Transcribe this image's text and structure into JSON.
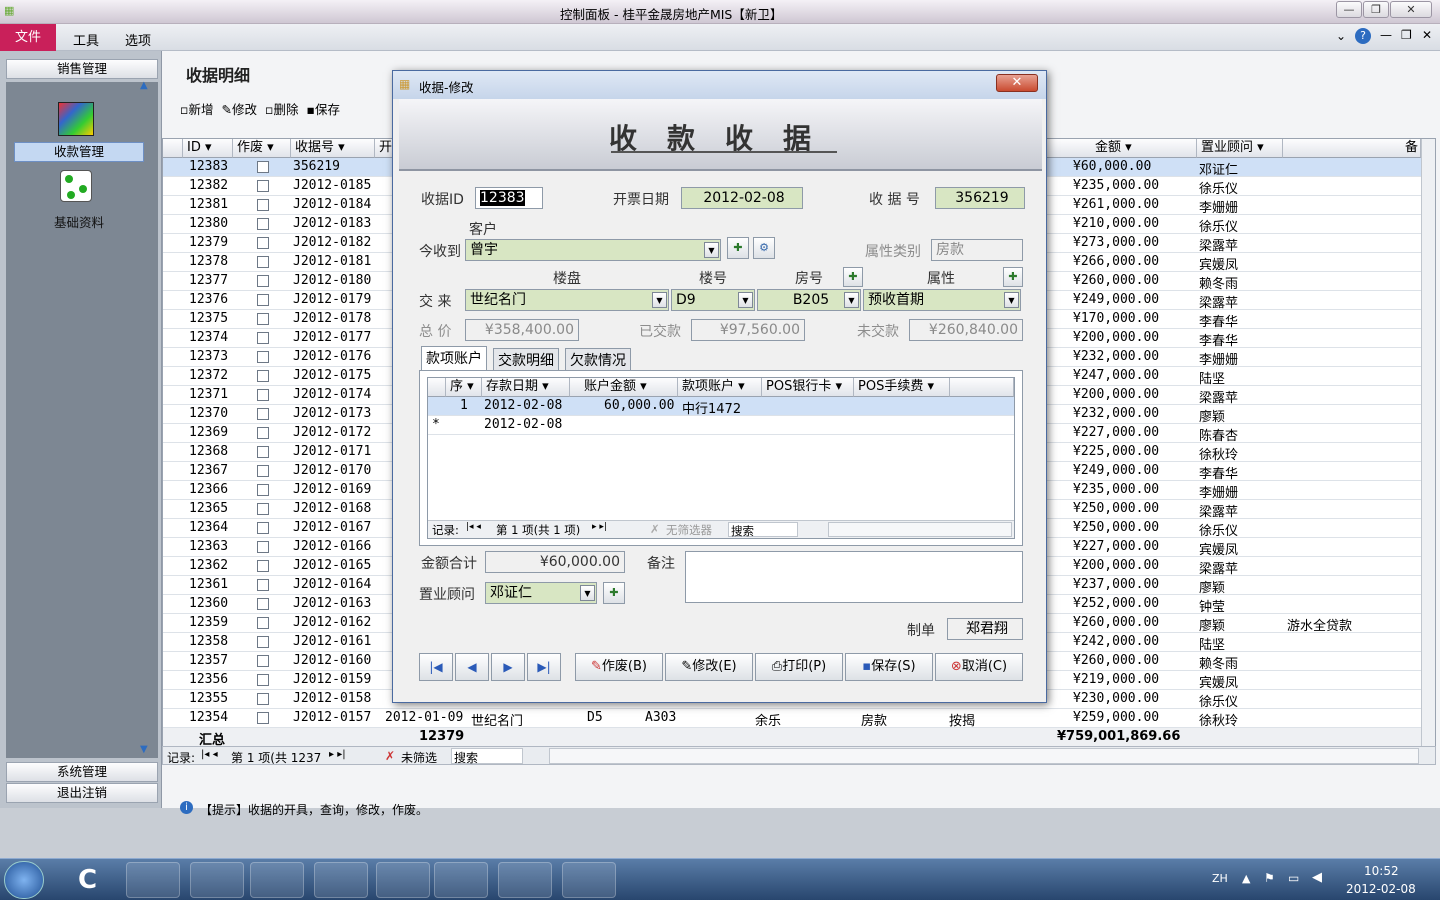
{
  "window": {
    "title": "控制面板 - 桂平金晟房地产MIS【新卫】"
  },
  "menu": {
    "file": "文件",
    "tools": "工具",
    "options": "选项"
  },
  "nav": {
    "sales": "销售管理",
    "items": [
      {
        "label": "收款管理",
        "icon": "receipt-icon"
      },
      {
        "label": "基础资料",
        "icon": "data-icon"
      }
    ],
    "system": "系统管理",
    "logout": "退出注销"
  },
  "page": {
    "title": "收据明细"
  },
  "toolbar": {
    "add": "新增",
    "edit": "修改",
    "delete": "删除",
    "save": "保存"
  },
  "grid": {
    "headers": [
      "ID",
      "作废",
      "收据号",
      "开",
      "金额",
      "置业顾问",
      "备"
    ],
    "rows": [
      {
        "id": "12383",
        "no": "356219",
        "amt": "¥60,000.00",
        "adv": "邓证仁",
        "sel": true
      },
      {
        "id": "12382",
        "no": "J2012-0185",
        "amt": "¥235,000.00",
        "adv": "徐乐仪"
      },
      {
        "id": "12381",
        "no": "J2012-0184",
        "amt": "¥261,000.00",
        "adv": "李姗姗"
      },
      {
        "id": "12380",
        "no": "J2012-0183",
        "amt": "¥210,000.00",
        "adv": "徐乐仪"
      },
      {
        "id": "12379",
        "no": "J2012-0182",
        "amt": "¥273,000.00",
        "adv": "梁露苹"
      },
      {
        "id": "12378",
        "no": "J2012-0181",
        "amt": "¥266,000.00",
        "adv": "宾媛凤"
      },
      {
        "id": "12377",
        "no": "J2012-0180",
        "amt": "¥260,000.00",
        "adv": "赖冬雨"
      },
      {
        "id": "12376",
        "no": "J2012-0179",
        "amt": "¥249,000.00",
        "adv": "梁露苹"
      },
      {
        "id": "12375",
        "no": "J2012-0178",
        "amt": "¥170,000.00",
        "adv": "李春华"
      },
      {
        "id": "12374",
        "no": "J2012-0177",
        "amt": "¥200,000.00",
        "adv": "李春华"
      },
      {
        "id": "12373",
        "no": "J2012-0176",
        "amt": "¥232,000.00",
        "adv": "李姗姗"
      },
      {
        "id": "12372",
        "no": "J2012-0175",
        "amt": "¥247,000.00",
        "adv": "陆坚"
      },
      {
        "id": "12371",
        "no": "J2012-0174",
        "amt": "¥200,000.00",
        "adv": "梁露苹"
      },
      {
        "id": "12370",
        "no": "J2012-0173",
        "amt": "¥232,000.00",
        "adv": "廖颖"
      },
      {
        "id": "12369",
        "no": "J2012-0172",
        "amt": "¥227,000.00",
        "adv": "陈春杏"
      },
      {
        "id": "12368",
        "no": "J2012-0171",
        "amt": "¥225,000.00",
        "adv": "徐秋玲"
      },
      {
        "id": "12367",
        "no": "J2012-0170",
        "amt": "¥249,000.00",
        "adv": "李春华"
      },
      {
        "id": "12366",
        "no": "J2012-0169",
        "amt": "¥235,000.00",
        "adv": "李姗姗"
      },
      {
        "id": "12365",
        "no": "J2012-0168",
        "amt": "¥250,000.00",
        "adv": "梁露苹"
      },
      {
        "id": "12364",
        "no": "J2012-0167",
        "amt": "¥250,000.00",
        "adv": "徐乐仪"
      },
      {
        "id": "12363",
        "no": "J2012-0166",
        "amt": "¥227,000.00",
        "adv": "宾媛凤"
      },
      {
        "id": "12362",
        "no": "J2012-0165",
        "amt": "¥200,000.00",
        "adv": "梁露苹"
      },
      {
        "id": "12361",
        "no": "J2012-0164",
        "amt": "¥237,000.00",
        "adv": "廖颖"
      },
      {
        "id": "12360",
        "no": "J2012-0163",
        "amt": "¥252,000.00",
        "adv": "钟莹"
      },
      {
        "id": "12359",
        "no": "J2012-0162",
        "amt": "¥260,000.00",
        "adv": "廖颖",
        "note": "游水全贷款"
      },
      {
        "id": "12358",
        "no": "J2012-0161",
        "amt": "¥242,000.00",
        "adv": "陆坚"
      },
      {
        "id": "12357",
        "no": "J2012-0160",
        "amt": "¥260,000.00",
        "adv": "赖冬雨"
      },
      {
        "id": "12356",
        "no": "J2012-0159",
        "amt": "¥219,000.00",
        "adv": "宾媛凤"
      },
      {
        "id": "12355",
        "no": "J2012-0158",
        "amt": "¥230,000.00",
        "adv": "徐乐仪"
      },
      {
        "id": "12354",
        "no": "J2012-0157",
        "amt": "¥259,000.00",
        "adv": "徐秋玲",
        "date": "2012-01-09",
        "estate": "世纪名门",
        "bld": "D5",
        "room": "A303",
        "cust": "余乐",
        "cat": "房款",
        "prop": "按揭"
      }
    ],
    "summary": {
      "label": "汇总",
      "count": "12379",
      "total": "¥759,001,869.66"
    },
    "footer": {
      "record": "记录:",
      "pos": "第 1 项(共 1237",
      "filter": "未筛选",
      "search": "搜索"
    }
  },
  "status": {
    "hint": "【提示】收据的开具，查询，修改，作废。"
  },
  "taskbar": {
    "lang": "ZH",
    "time": "10:52",
    "date": "2012-02-08"
  },
  "dialog": {
    "title": "收据-修改",
    "banner": "收款收据",
    "receipt_id_label": "收据ID",
    "receipt_id": "12383",
    "issue_date_label": "开票日期",
    "issue_date": "2012-02-08",
    "receipt_no_label": "收 据 号",
    "receipt_no": "356219",
    "customer_label": "客户",
    "received_from_label": "今收到",
    "customer": "曾宇",
    "prop_cat_label": "属性类别",
    "prop_cat": "房款",
    "estate_label": "楼盘",
    "building_label": "楼号",
    "room_label": "房号",
    "property_label": "属性",
    "deal_label": "交 来",
    "estate": "世纪名门",
    "building": "D9",
    "room": "B205",
    "property": "预收首期",
    "total_price_label": "总 价",
    "total_price": "¥358,400.00",
    "paid_label": "已交款",
    "paid": "¥97,560.00",
    "unpaid_label": "未交款",
    "unpaid": "¥260,840.00",
    "tabs": [
      "款项账户",
      "交款明细",
      "欠款情况"
    ],
    "sub_headers": [
      "序",
      "存款日期",
      "账户金额",
      "款项账户",
      "POS银行卡",
      "POS手续费"
    ],
    "sub_rows": [
      {
        "seq": "1",
        "date": "2012-02-08",
        "amt": "60,000.00",
        "acct": "中行1472"
      },
      {
        "seq": "*",
        "date": "2012-02-08",
        "amt": "",
        "acct": ""
      }
    ],
    "sub_footer": {
      "record": "记录:",
      "pos": "第 1 项(共 1 项)",
      "filter": "无筛选器",
      "search": "搜索"
    },
    "sum_label": "金额合计",
    "sum": "¥60,000.00",
    "remark_label": "备注",
    "advisor_label": "置业顾问",
    "advisor": "邓证仁",
    "maker_label": "制单",
    "maker": "郑君翔",
    "buttons": {
      "void": "作废(B)",
      "edit": "修改(E)",
      "print": "打印(P)",
      "save": "保存(S)",
      "cancel": "取消(C)"
    }
  }
}
